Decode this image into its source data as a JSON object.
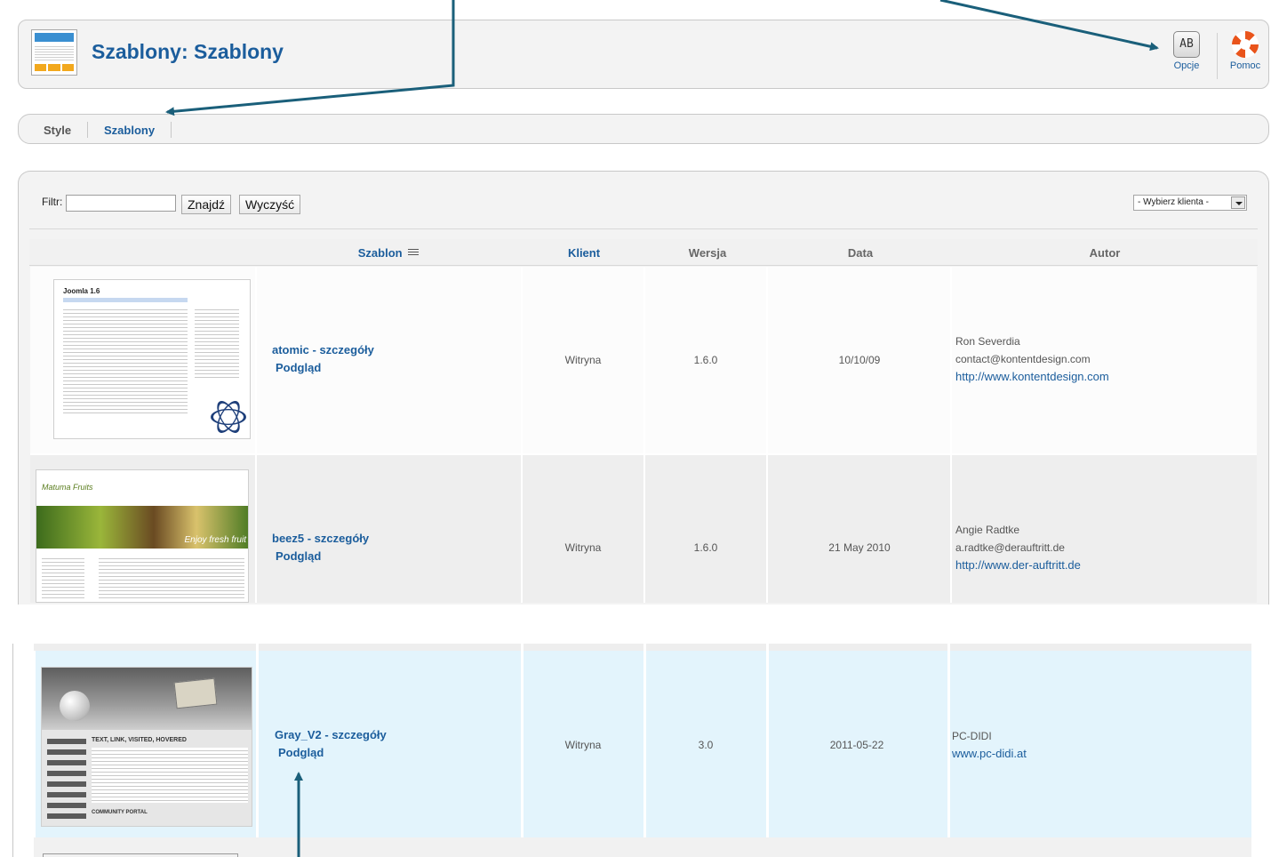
{
  "header": {
    "title": "Szablony: Szablony",
    "toolbar": [
      {
        "label": "Opcje",
        "icon": "options-icon"
      },
      {
        "label": "Pomoc",
        "icon": "help-icon"
      }
    ],
    "options_glyph": "AB"
  },
  "tabs": [
    {
      "label": "Style",
      "active": false
    },
    {
      "label": "Szablony",
      "active": true
    }
  ],
  "filter": {
    "label": "Filtr:",
    "value": "",
    "search_button": "Znajdź",
    "clear_button": "Wyczyść",
    "client_select": "- Wybierz klienta -"
  },
  "table": {
    "columns": [
      "",
      "Szablon",
      "Klient",
      "Wersja",
      "Data",
      "Autor"
    ],
    "rows": [
      {
        "name": "atomic - szczegóły",
        "preview": "Podgląd",
        "client": "Witryna",
        "version": "1.6.0",
        "date": "10/10/09",
        "author": "Ron Severdia",
        "email": "contact@kontentdesign.com",
        "url": "http://www.kontentdesign.com",
        "thumb_heading": "Joomla 1.6"
      },
      {
        "name": "beez5 - szczegóły",
        "preview": "Podgląd",
        "client": "Witryna",
        "version": "1.6.0",
        "date": "21 May 2010",
        "author": "Angie Radtke",
        "email": "a.radtke@derauftritt.de",
        "url": "http://www.der-auftritt.de",
        "thumb_heading": "Enjoy fresh fruit"
      },
      {
        "name": "Gray_V2 - szczegóły",
        "preview": "Podgląd",
        "client": "Witryna",
        "version": "3.0",
        "date": "2011-05-22",
        "author": "PC-DIDI",
        "email": "",
        "url": "www.pc-didi.at",
        "thumb_heading": "TEXT, LINK, VISITED, HOVERED"
      }
    ]
  },
  "colors": {
    "link": "#1b5d9c",
    "arrow": "#1a5f7a",
    "highlight_row": "#e3f4fc"
  }
}
